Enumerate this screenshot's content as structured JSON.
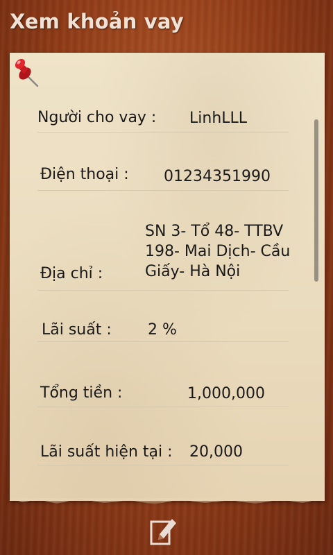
{
  "header": {
    "title": "Xem khoản vay"
  },
  "loan": {
    "lender_label": "Người cho vay :",
    "lender_value": "LinhLLL",
    "phone_label": "Điện thoại :",
    "phone_value": "01234351990",
    "address_label": "Địa chỉ :",
    "address_value": "SN 3- Tổ 48- TTBV 198- Mai Dịch- Cầu Giấy- Hà Nội",
    "rate_label": "Lãi suất :",
    "rate_value": "2 %",
    "total_label": "Tổng tiền :",
    "total_value": "1,000,000",
    "current_interest_label": "Lãi suất hiện tại :",
    "current_interest_value": "20,000"
  },
  "icons": {
    "pin": "pushpin-icon",
    "edit": "edit-icon"
  },
  "colors": {
    "background": "#8e3a16",
    "paper": "#eadbbd",
    "title_text": "#f1e2d6",
    "pin": "#d21f26"
  }
}
